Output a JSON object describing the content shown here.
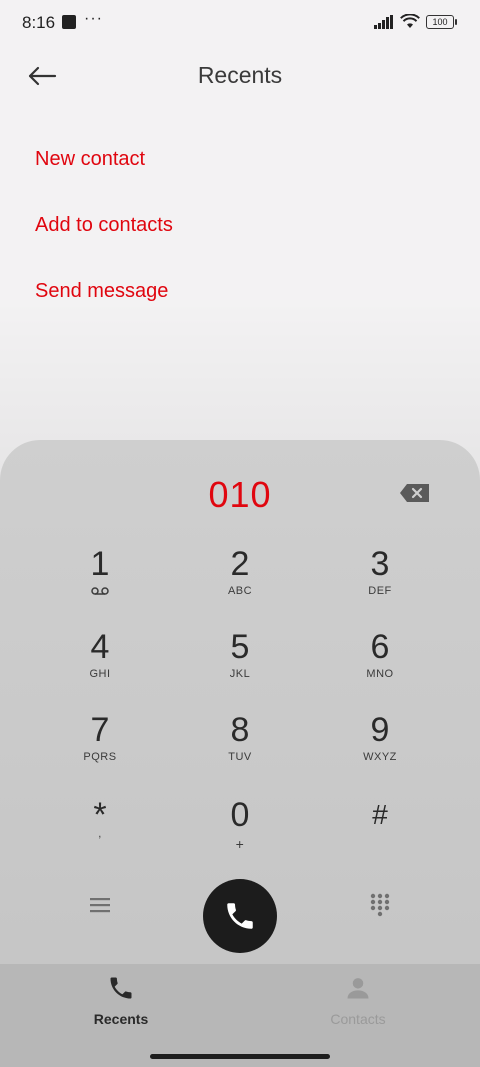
{
  "status_bar": {
    "time": "8:16",
    "dots": "···",
    "battery": "100"
  },
  "header": {
    "title": "Recents"
  },
  "actions": {
    "new_contact": "New contact",
    "add_to_contacts": "Add to contacts",
    "send_message": "Send message"
  },
  "dialpad": {
    "number": "010",
    "keys": [
      {
        "digit": "1",
        "letters": "voicemail-icon"
      },
      {
        "digit": "2",
        "letters": "ABC"
      },
      {
        "digit": "3",
        "letters": "DEF"
      },
      {
        "digit": "4",
        "letters": "GHI"
      },
      {
        "digit": "5",
        "letters": "JKL"
      },
      {
        "digit": "6",
        "letters": "MNO"
      },
      {
        "digit": "7",
        "letters": "PQRS"
      },
      {
        "digit": "8",
        "letters": "TUV"
      },
      {
        "digit": "9",
        "letters": "WXYZ"
      },
      {
        "digit": "*",
        "letters": ","
      },
      {
        "digit": "0",
        "letters": "+"
      },
      {
        "digit": "#",
        "letters": ""
      }
    ]
  },
  "bottom_nav": {
    "recents": "Recents",
    "contacts": "Contacts"
  },
  "colors": {
    "accent": "#e0060f",
    "dialpad_bg": "#c9c9c9",
    "call_button": "#1c1c1c"
  }
}
